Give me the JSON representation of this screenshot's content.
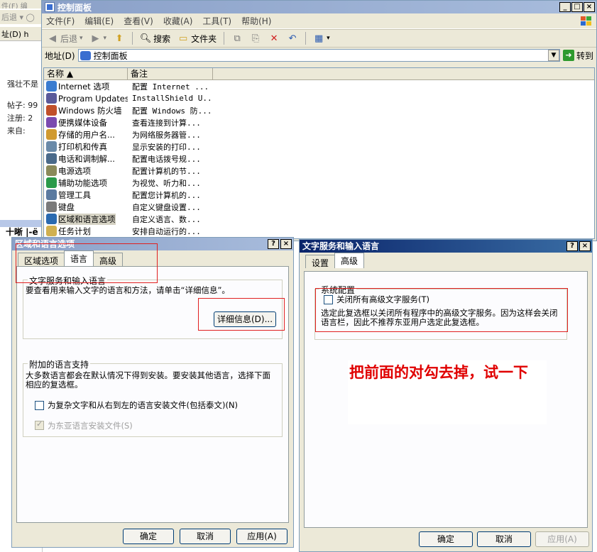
{
  "background": {
    "menu_text": "件(F)   编",
    "toolbar_text": "后退 ▾ ◯",
    "address_text": "址(D) h",
    "snippets": [
      "强壮不是",
      "帖子: 99",
      "注册: 2",
      "来自:"
    ],
    "separator_text": "十晰 |-ë"
  },
  "control_panel": {
    "title": "控制面板",
    "win_buttons": [
      "_",
      "□",
      "×"
    ],
    "menu": [
      "文件(F)",
      "编辑(E)",
      "查看(V)",
      "收藏(A)",
      "工具(T)",
      "帮助(H)"
    ],
    "toolbar": {
      "back": "后退",
      "search": "搜索",
      "folders": "文件夹"
    },
    "address_label": "地址(D)",
    "address_value": "控制面板",
    "go_label": "转到",
    "columns": [
      "名称 ▲",
      "备注"
    ],
    "items": [
      {
        "name": "Internet 选项",
        "note": "配置 Internet ...",
        "icon": "internet-icon",
        "color": "#3a7cd0"
      },
      {
        "name": "Program Updates",
        "note": "InstallShield U...",
        "icon": "program-updates-icon",
        "color": "#5a5a9a"
      },
      {
        "name": "Windows 防火墙",
        "note": "配置 Windows 防...",
        "icon": "firewall-icon",
        "color": "#c0502a"
      },
      {
        "name": "便携媒体设备",
        "note": "查看连接到计算...",
        "icon": "media-device-icon",
        "color": "#7a4ab0"
      },
      {
        "name": "存储的用户名...",
        "note": "为网络服务器管...",
        "icon": "user-keys-icon",
        "color": "#d09a30"
      },
      {
        "name": "打印机和传真",
        "note": "显示安装的打印...",
        "icon": "printer-icon",
        "color": "#6a8aa8"
      },
      {
        "name": "电话和调制解...",
        "note": "配置电话拨号规...",
        "icon": "phone-icon",
        "color": "#4a6a8a"
      },
      {
        "name": "电源选项",
        "note": "配置计算机的节...",
        "icon": "power-icon",
        "color": "#8a8a5a"
      },
      {
        "name": "辅助功能选项",
        "note": "为视觉、听力和...",
        "icon": "accessibility-icon",
        "color": "#2a9a4a"
      },
      {
        "name": "管理工具",
        "note": "配置您计算机的...",
        "icon": "admin-tools-icon",
        "color": "#5a7aa0"
      },
      {
        "name": "键盘",
        "note": "自定义键盘设置...",
        "icon": "keyboard-icon",
        "color": "#7a7a7a"
      },
      {
        "name": "区域和语言选项",
        "note": "自定义语言、数...",
        "icon": "globe-icon",
        "color": "#2a6ab0",
        "selected": true
      },
      {
        "name": "任务计划",
        "note": "安排自动运行的...",
        "icon": "scheduled-tasks-icon",
        "color": "#d0b050"
      }
    ]
  },
  "regional_dialog": {
    "title": "区域和语言选项",
    "help_btn": "?",
    "close_btn": "×",
    "tabs": [
      "区域选项",
      "语言",
      "高级"
    ],
    "group1_legend": "文字服务和输入语言",
    "group1_text": "要查看用来输入文字的语言和方法，请单击“详细信息”。",
    "details_button": "详细信息(D)...",
    "group2_legend": "附加的语言支持",
    "group2_text": "大多数语言都会在默认情况下得到安装。要安装其他语言，选择下面相应的复选框。",
    "complex_script": "为复杂文字和从右到左的语言安装文件(包括泰文)(N)",
    "east_asian": "为东亚语言安装文件(S)",
    "ok": "确定",
    "cancel": "取消",
    "apply": "应用(A)"
  },
  "text_services_dialog": {
    "title": "文字服务和输入语言",
    "help_btn": "?",
    "close_btn": "×",
    "tabs": [
      "设置",
      "高级"
    ],
    "group_legend": "系统配置",
    "checkbox_label": "关闭所有高级文字服务(T)",
    "description": "选定此复选框以关闭所有程序中的高级文字服务。因为这样会关闭语言栏，因此不推荐东亚用户选定此复选框。",
    "ok": "确定",
    "cancel": "取消",
    "apply": "应用(A)"
  },
  "annotation": {
    "text": "把前面的对勾去掉，试一下"
  },
  "colors": {
    "accent_red": "#e02020",
    "annotation_red": "#e00000",
    "active_title": "#0a246a",
    "inactive_title": "#8aa0c8"
  }
}
